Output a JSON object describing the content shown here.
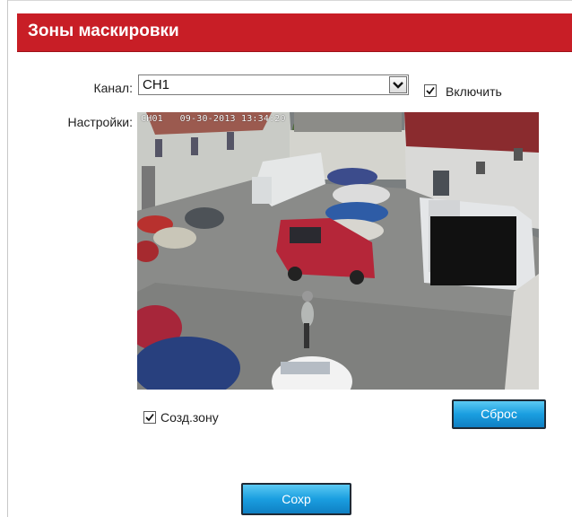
{
  "page": {
    "title": "Зоны маскировки"
  },
  "form": {
    "channel_label": "Канал:",
    "channel_value": "CH1",
    "enable_label": "Включить",
    "enable_checked": true,
    "settings_label": "Настройки:",
    "create_zone_label": "Созд.зону",
    "create_zone_checked": true,
    "reset_button": "Сброс",
    "save_button": "Сохр"
  },
  "video": {
    "osd_channel": "CH01",
    "osd_datetime": "09-30-2013 13:34:20"
  }
}
